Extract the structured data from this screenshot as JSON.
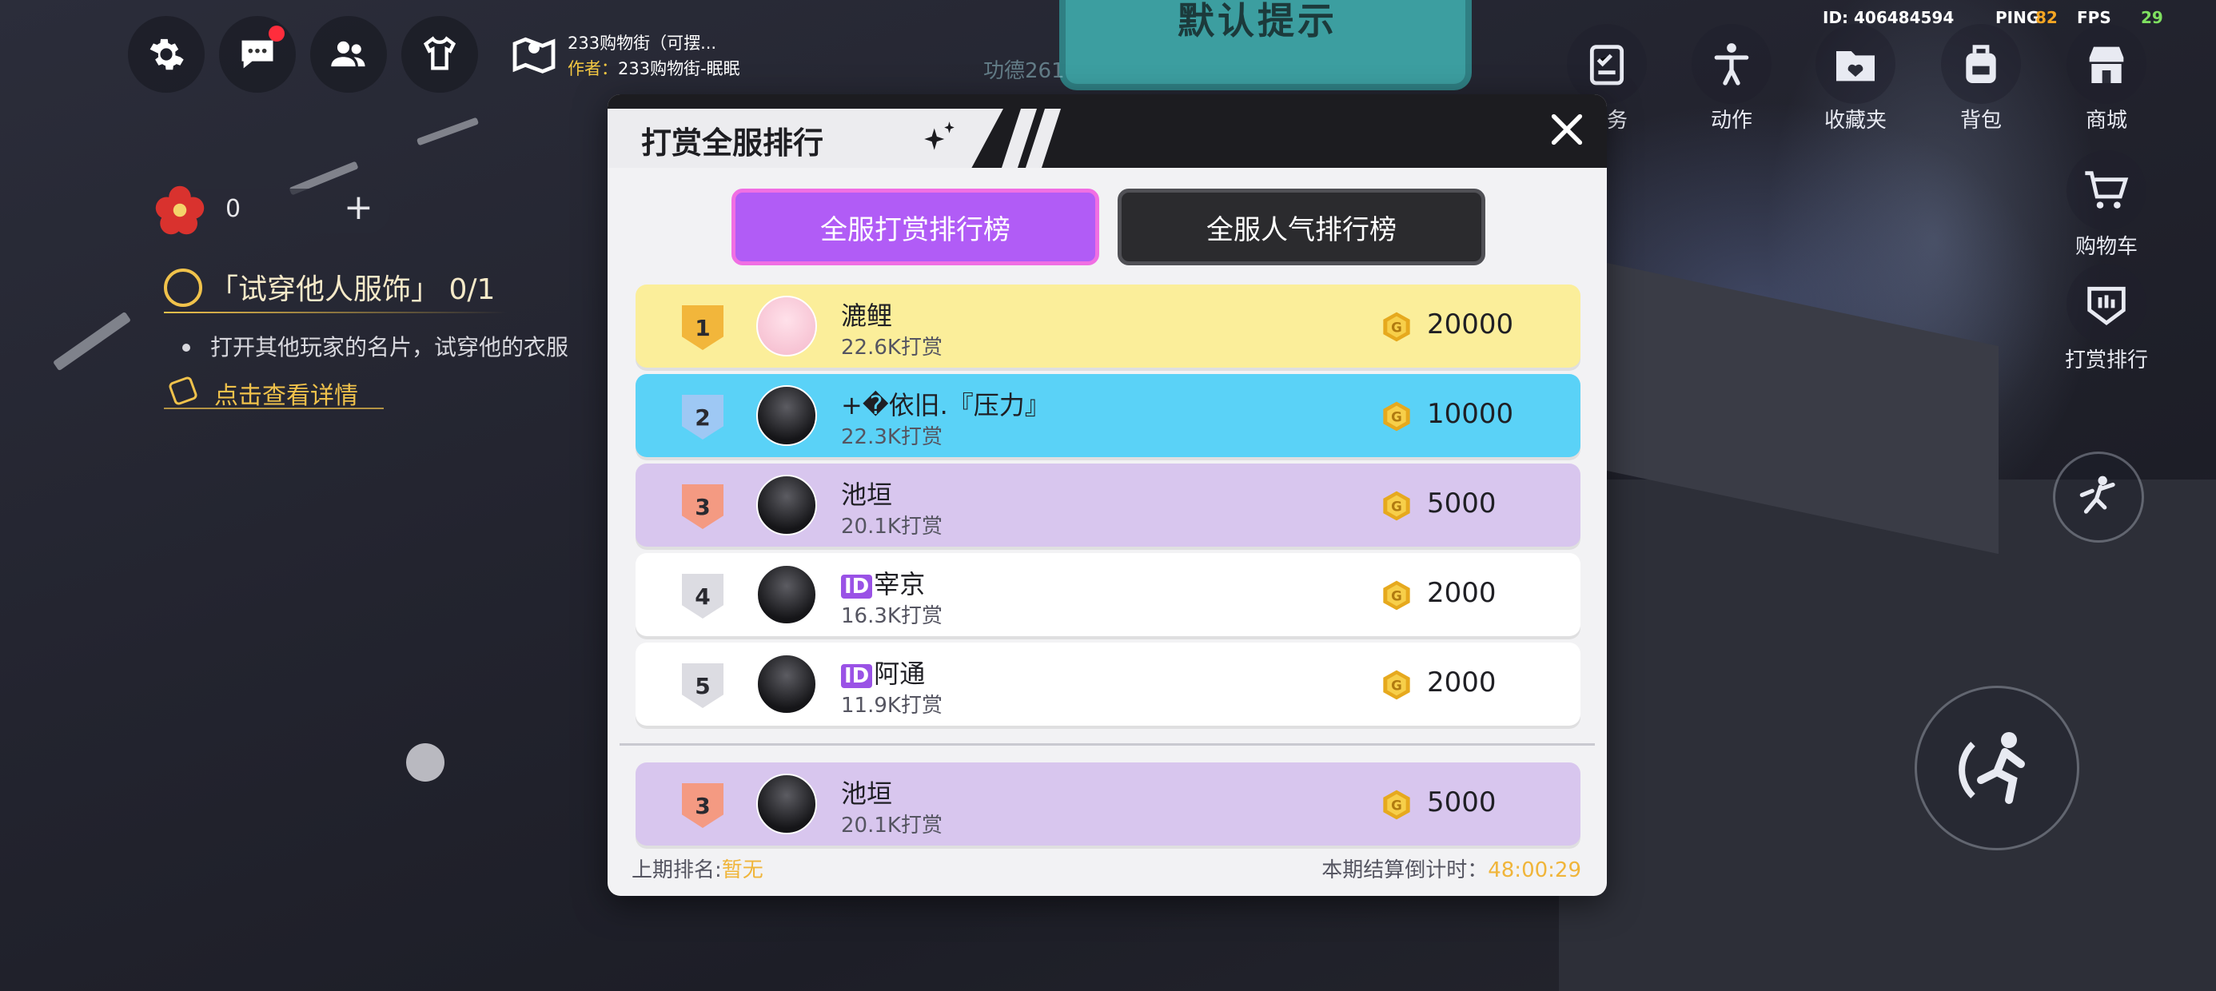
{
  "hud": {
    "map_title": "233购物街（可摆...",
    "author_label": "作者：",
    "author_name": "233购物街-眠眠",
    "id_text": "ID: 406484594",
    "ping_label": "PING",
    "ping_value": "82",
    "fps_label": "FPS",
    "fps_value": "29",
    "billboard_text": "默认提示",
    "faded_text": "功德261",
    "flower_count": "0",
    "task_title": "「试穿他人服饰」 0/1",
    "task_desc": "打开其他玩家的名片，试穿他的衣服",
    "task_link": "点击查看详情"
  },
  "right_menu": [
    {
      "label": "任务",
      "icon": "clipboard-icon"
    },
    {
      "label": "动作",
      "icon": "pose-icon"
    },
    {
      "label": "收藏夹",
      "icon": "folder-heart-icon"
    },
    {
      "label": "背包",
      "icon": "backpack-icon"
    },
    {
      "label": "商城",
      "icon": "store-icon"
    },
    {
      "label": "购物车",
      "icon": "cart-icon"
    },
    {
      "label": "打赏排行",
      "icon": "rank-icon"
    }
  ],
  "modal": {
    "title": "打赏全服排行",
    "tab_active": "全服打赏排行榜",
    "tab_inactive": "全服人气排行榜",
    "rows": [
      {
        "rank": "1",
        "name": "漉鲤",
        "sub": "22.6K打赏",
        "amount": "20000",
        "id_badge": false,
        "bg": "#fbee9a",
        "rank_color": "#f2b63b"
      },
      {
        "rank": "2",
        "name": "+�依旧.『压力』",
        "sub": "22.3K打赏",
        "amount": "10000",
        "id_badge": false,
        "bg": "#5ad2f7",
        "rank_color": "#9ec8f4"
      },
      {
        "rank": "3",
        "name": "池垣",
        "sub": "20.1K打赏",
        "amount": "5000",
        "id_badge": false,
        "bg": "#d8c6ee",
        "rank_color": "#f49a82"
      },
      {
        "rank": "4",
        "name": "宰京",
        "sub": "16.3K打赏",
        "amount": "2000",
        "id_badge": true,
        "bg": "#ffffff",
        "rank_color": "#dcdce2"
      },
      {
        "rank": "5",
        "name": "阿通",
        "sub": "11.9K打赏",
        "amount": "2000",
        "id_badge": true,
        "bg": "#ffffff",
        "rank_color": "#dcdce2"
      }
    ],
    "self_row": {
      "rank": "3",
      "name": "池垣",
      "sub": "20.1K打赏",
      "amount": "5000",
      "bg": "#d8c6ee",
      "rank_color": "#f49a82"
    },
    "id_badge_text": "ID",
    "prev_rank_label": "上期排名:",
    "prev_rank_value": "暂无",
    "countdown_label": "本期结算倒计时：",
    "countdown_value": "48:00:29"
  }
}
